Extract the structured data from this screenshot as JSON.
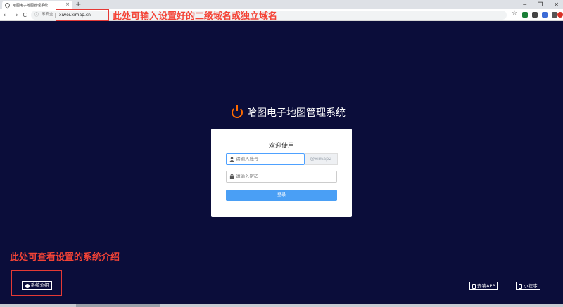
{
  "browser": {
    "tab_title": "哈图电子地图管理系统",
    "tab_close": "×",
    "new_tab": "+",
    "window_controls": [
      "─",
      "❐",
      "✕"
    ],
    "nav": [
      "←",
      "→",
      "C"
    ],
    "security_label": "不安全",
    "url": "xiwei.ximap.cn",
    "star": "☆",
    "extension_colors": [
      "#1a7f37",
      "#444444",
      "#3c6bd6",
      "#555555",
      "#d93025"
    ]
  },
  "annotations": {
    "top": "此处可输入设置好的二级域名或独立域名",
    "bottom": "此处可查看设置的系统介绍"
  },
  "brand": {
    "title": "哈图电子地图管理系统",
    "accent": "#ff6b00"
  },
  "login": {
    "welcome": "欢迎使用",
    "account_placeholder": "请输入账号",
    "account_suffix": "@ximap2",
    "password_placeholder": "请输入密码",
    "submit_label": "登录"
  },
  "footer": {
    "intro_label": "系统介绍",
    "android_label": "安装APP",
    "mini_program_label": "小程序"
  }
}
